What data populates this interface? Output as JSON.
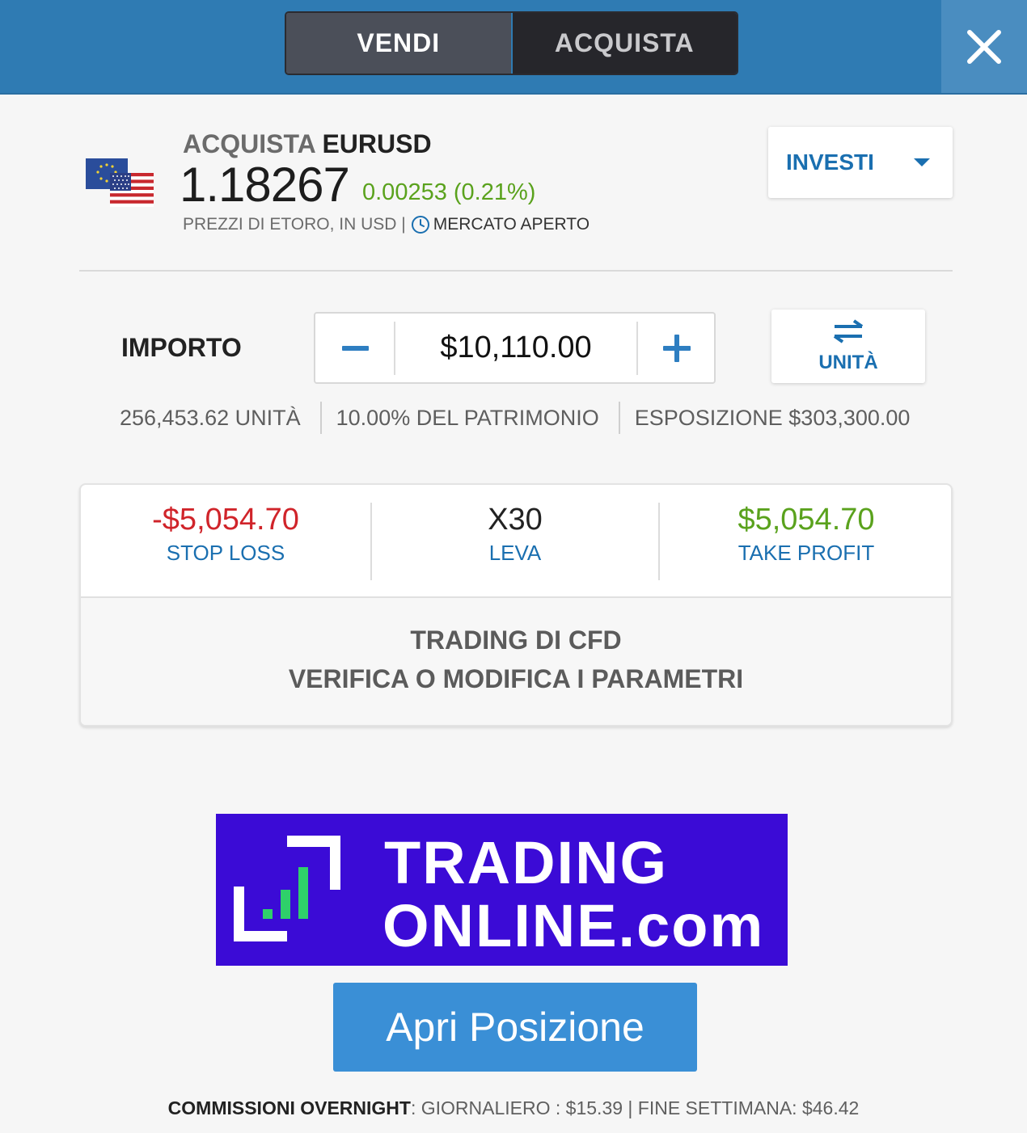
{
  "header": {
    "tabs": [
      {
        "label": "VENDI",
        "active": true
      },
      {
        "label": "ACQUISTA",
        "active": false
      }
    ],
    "close_icon": "close-icon"
  },
  "instrument": {
    "action": "ACQUISTA",
    "symbol": "EURUSD",
    "price": "1.18267",
    "change": "0.00253 (0.21%)",
    "prices_note": "PREZZI DI ETORO, IN USD |",
    "market_status": "MERCATO APERTO",
    "flag_icon": "eu-us-flag-icon"
  },
  "order_mode": {
    "label": "INVESTI",
    "caret_icon": "caret-down-icon"
  },
  "amount": {
    "label": "IMPORTO",
    "value": "$10,110.00",
    "units_toggle_label": "UNITÀ"
  },
  "stats": {
    "units": "256,453.62 UNITÀ",
    "equity": "10.00% DEL PATRIMONIO",
    "exposure": "ESPOSIZIONE $303,300.00"
  },
  "params": {
    "stop_loss": {
      "value": "-$5,054.70",
      "label": "STOP LOSS"
    },
    "leverage": {
      "value": "X30",
      "label": "LEVA"
    },
    "take_profit": {
      "value": "$5,054.70",
      "label": "TAKE PROFIT"
    },
    "cfd_line1": "TRADING DI CFD",
    "cfd_line2": "VERIFICA O MODIFICA I PARAMETRI"
  },
  "logo": {
    "line1": "TRADING",
    "line2": "ONLINE.com"
  },
  "open_button": "Apri Posizione",
  "fees": {
    "title": "COMMISSIONI OVERNIGHT",
    "rest": ": GIORNALIERO : $15.39 | FINE SETTIMANA: $46.42"
  },
  "colors": {
    "header_blue": "#2f7bb3",
    "accent_blue": "#1a6fb0",
    "positive_green": "#5aa21d",
    "negative_red": "#d0242a",
    "button_blue": "#3a8fd6",
    "logo_purple": "#3b0bd6"
  }
}
